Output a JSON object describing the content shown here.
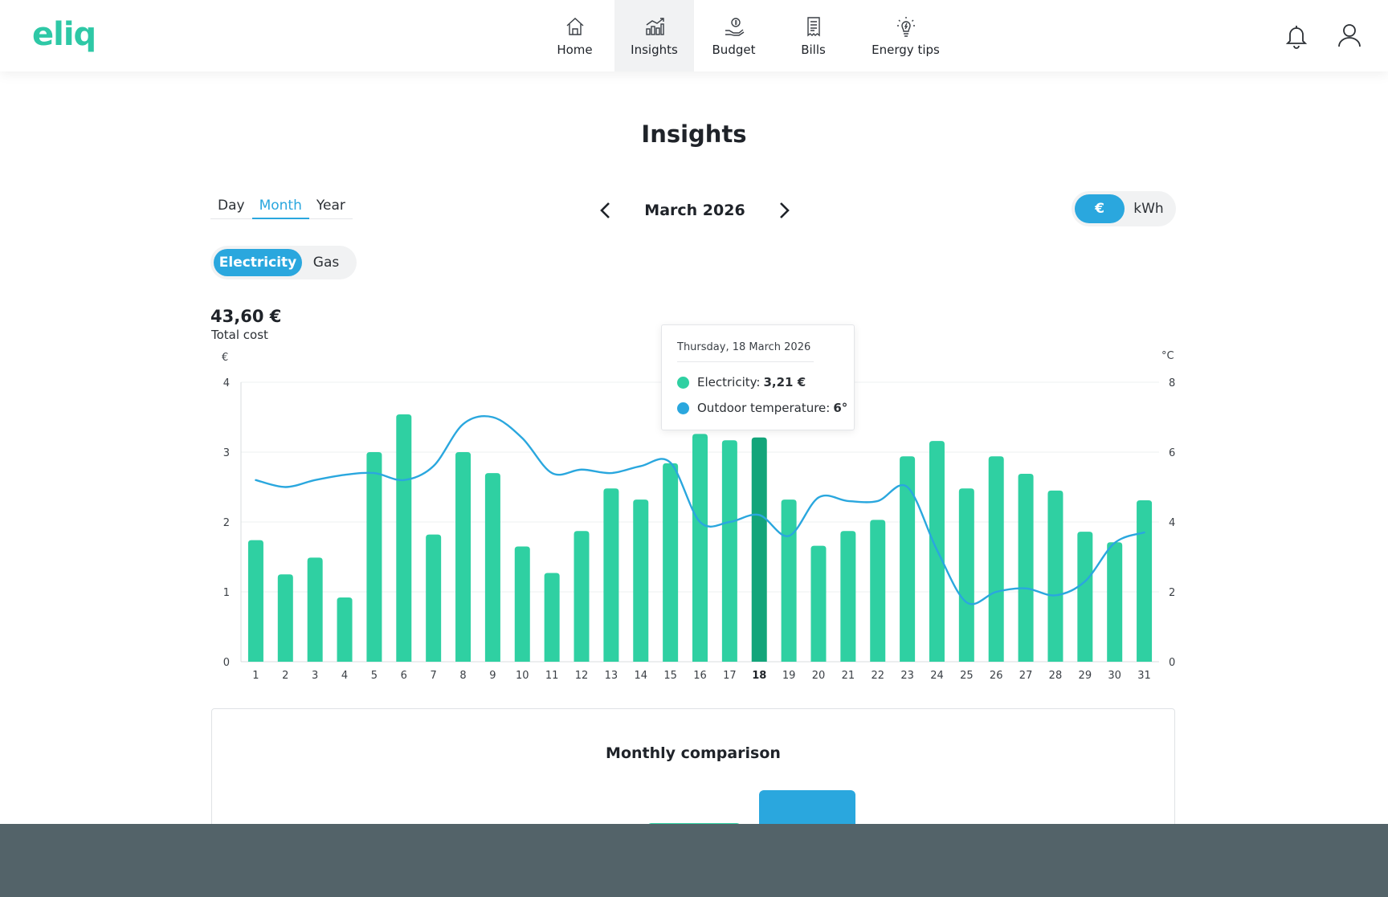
{
  "app": {
    "logo_text": "eliq"
  },
  "nav": {
    "items": [
      {
        "label": "Home",
        "icon": "home-icon"
      },
      {
        "label": "Insights",
        "icon": "insights-icon",
        "active": true
      },
      {
        "label": "Budget",
        "icon": "budget-icon"
      },
      {
        "label": "Bills",
        "icon": "bills-icon"
      },
      {
        "label": "Energy tips",
        "icon": "energy-tips-icon"
      }
    ],
    "notification_icon": "bell-icon",
    "profile_icon": "user-icon"
  },
  "page": {
    "title": "Insights"
  },
  "period_tabs": {
    "day": "Day",
    "month": "Month",
    "year": "Year",
    "selected": "Month"
  },
  "month_selector": {
    "label": "March 2026"
  },
  "unit_toggle": {
    "euro": "€",
    "kwh": "kWh",
    "selected": "€"
  },
  "energy_toggle": {
    "electricity": "Electricity",
    "gas": "Gas",
    "selected": "Electricity"
  },
  "summary": {
    "total_value": "43,60 €",
    "total_label": "Total cost"
  },
  "tooltip": {
    "date": "Thursday, 18 March 2026",
    "electricity_label": "Electricity:",
    "electricity_value": "3,21 €",
    "temperature_label": "Outdoor temperature:",
    "temperature_value": "6°"
  },
  "colors": {
    "bar": "#2fd0a2",
    "bar_selected": "#13a57a",
    "temperature_line": "#2aa7de",
    "accent": "#2aa7de"
  },
  "chart_data": {
    "type": "bar",
    "left_axis_unit": "€",
    "right_axis_unit": "°C",
    "ylim": [
      0,
      4
    ],
    "y2lim": [
      0,
      8
    ],
    "yticks": [
      0,
      1,
      2,
      3,
      4
    ],
    "y2ticks": [
      0,
      2,
      4,
      6,
      8
    ],
    "grid": true,
    "selected_category": "18",
    "categories": [
      "1",
      "2",
      "3",
      "4",
      "5",
      "6",
      "7",
      "8",
      "9",
      "10",
      "11",
      "12",
      "13",
      "14",
      "15",
      "16",
      "17",
      "18",
      "19",
      "20",
      "21",
      "22",
      "23",
      "24",
      "25",
      "26",
      "27",
      "28",
      "29",
      "30",
      "31"
    ],
    "series": [
      {
        "type": "bar",
        "axis": "left",
        "values": [
          1.74,
          1.25,
          1.49,
          0.92,
          3.0,
          3.54,
          1.82,
          3.0,
          2.7,
          1.65,
          1.27,
          1.87,
          2.48,
          2.32,
          2.84,
          3.26,
          3.17,
          3.21,
          2.32,
          1.66,
          1.87,
          2.03,
          2.94,
          3.16,
          2.48,
          2.94,
          2.69,
          2.45,
          1.86,
          1.71,
          2.31
        ]
      },
      {
        "type": "line",
        "axis": "right",
        "values": [
          5.2,
          5.0,
          5.2,
          5.35,
          5.4,
          5.2,
          5.6,
          6.8,
          7.0,
          6.4,
          5.4,
          5.5,
          5.4,
          5.6,
          5.7,
          4.0,
          4.0,
          4.2,
          3.6,
          4.7,
          4.6,
          4.6,
          5.0,
          3.2,
          1.7,
          2.0,
          2.1,
          1.9,
          2.3,
          3.4,
          3.7
        ]
      }
    ]
  },
  "comparison": {
    "title": "Monthly comparison"
  }
}
